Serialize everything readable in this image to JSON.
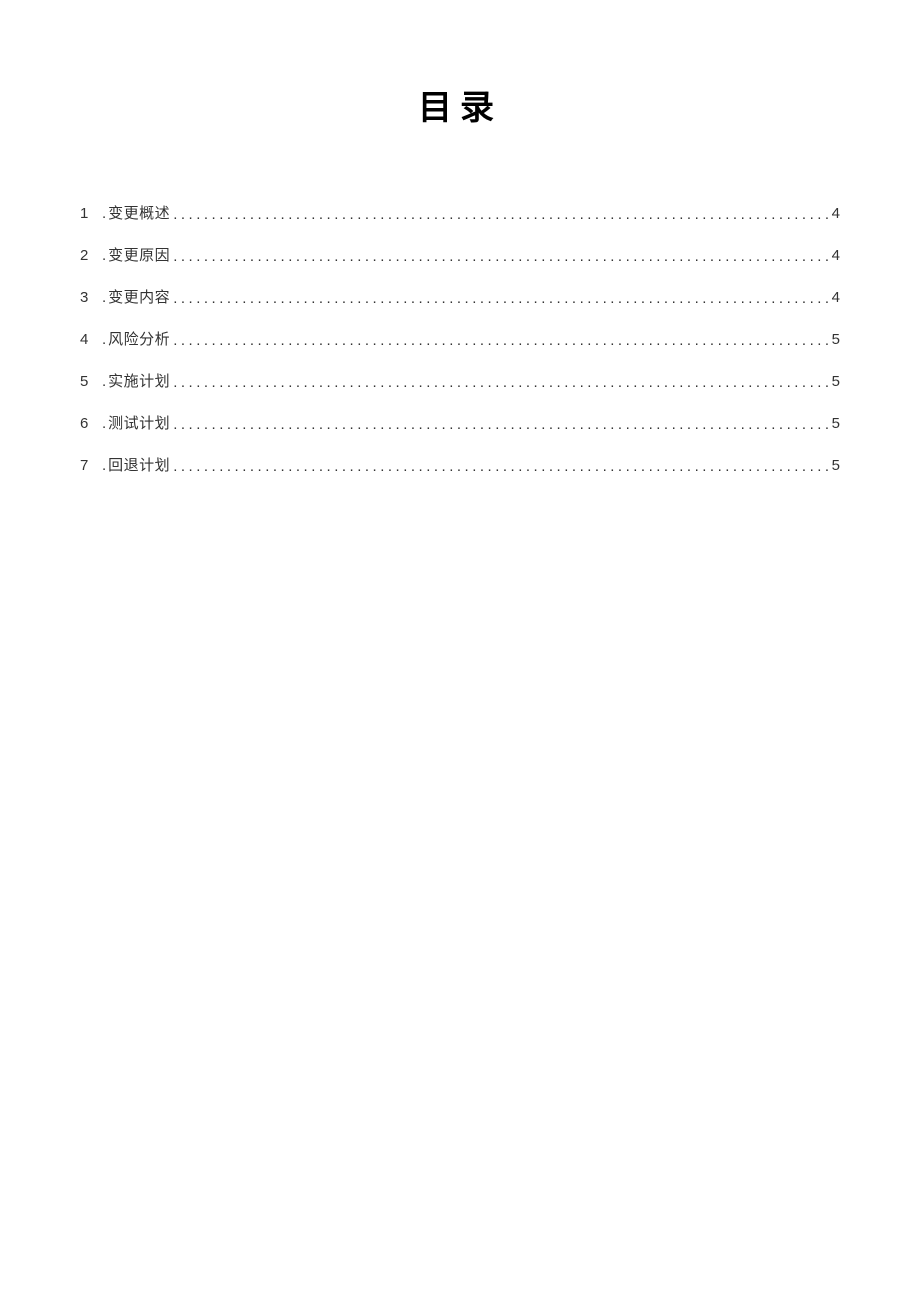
{
  "title": "目录",
  "toc": [
    {
      "num": "1",
      "label": "变更概述",
      "page": "4"
    },
    {
      "num": "2",
      "label": "变更原因",
      "page": "4"
    },
    {
      "num": "3",
      "label": "变更内容",
      "page": "4"
    },
    {
      "num": "4",
      "label": "风险分析",
      "page": "5"
    },
    {
      "num": "5",
      "label": "实施计划",
      "page": "5"
    },
    {
      "num": "6",
      "label": "测试计划",
      "page": "5"
    },
    {
      "num": "7",
      "label": "回退计划",
      "page": "5"
    }
  ]
}
